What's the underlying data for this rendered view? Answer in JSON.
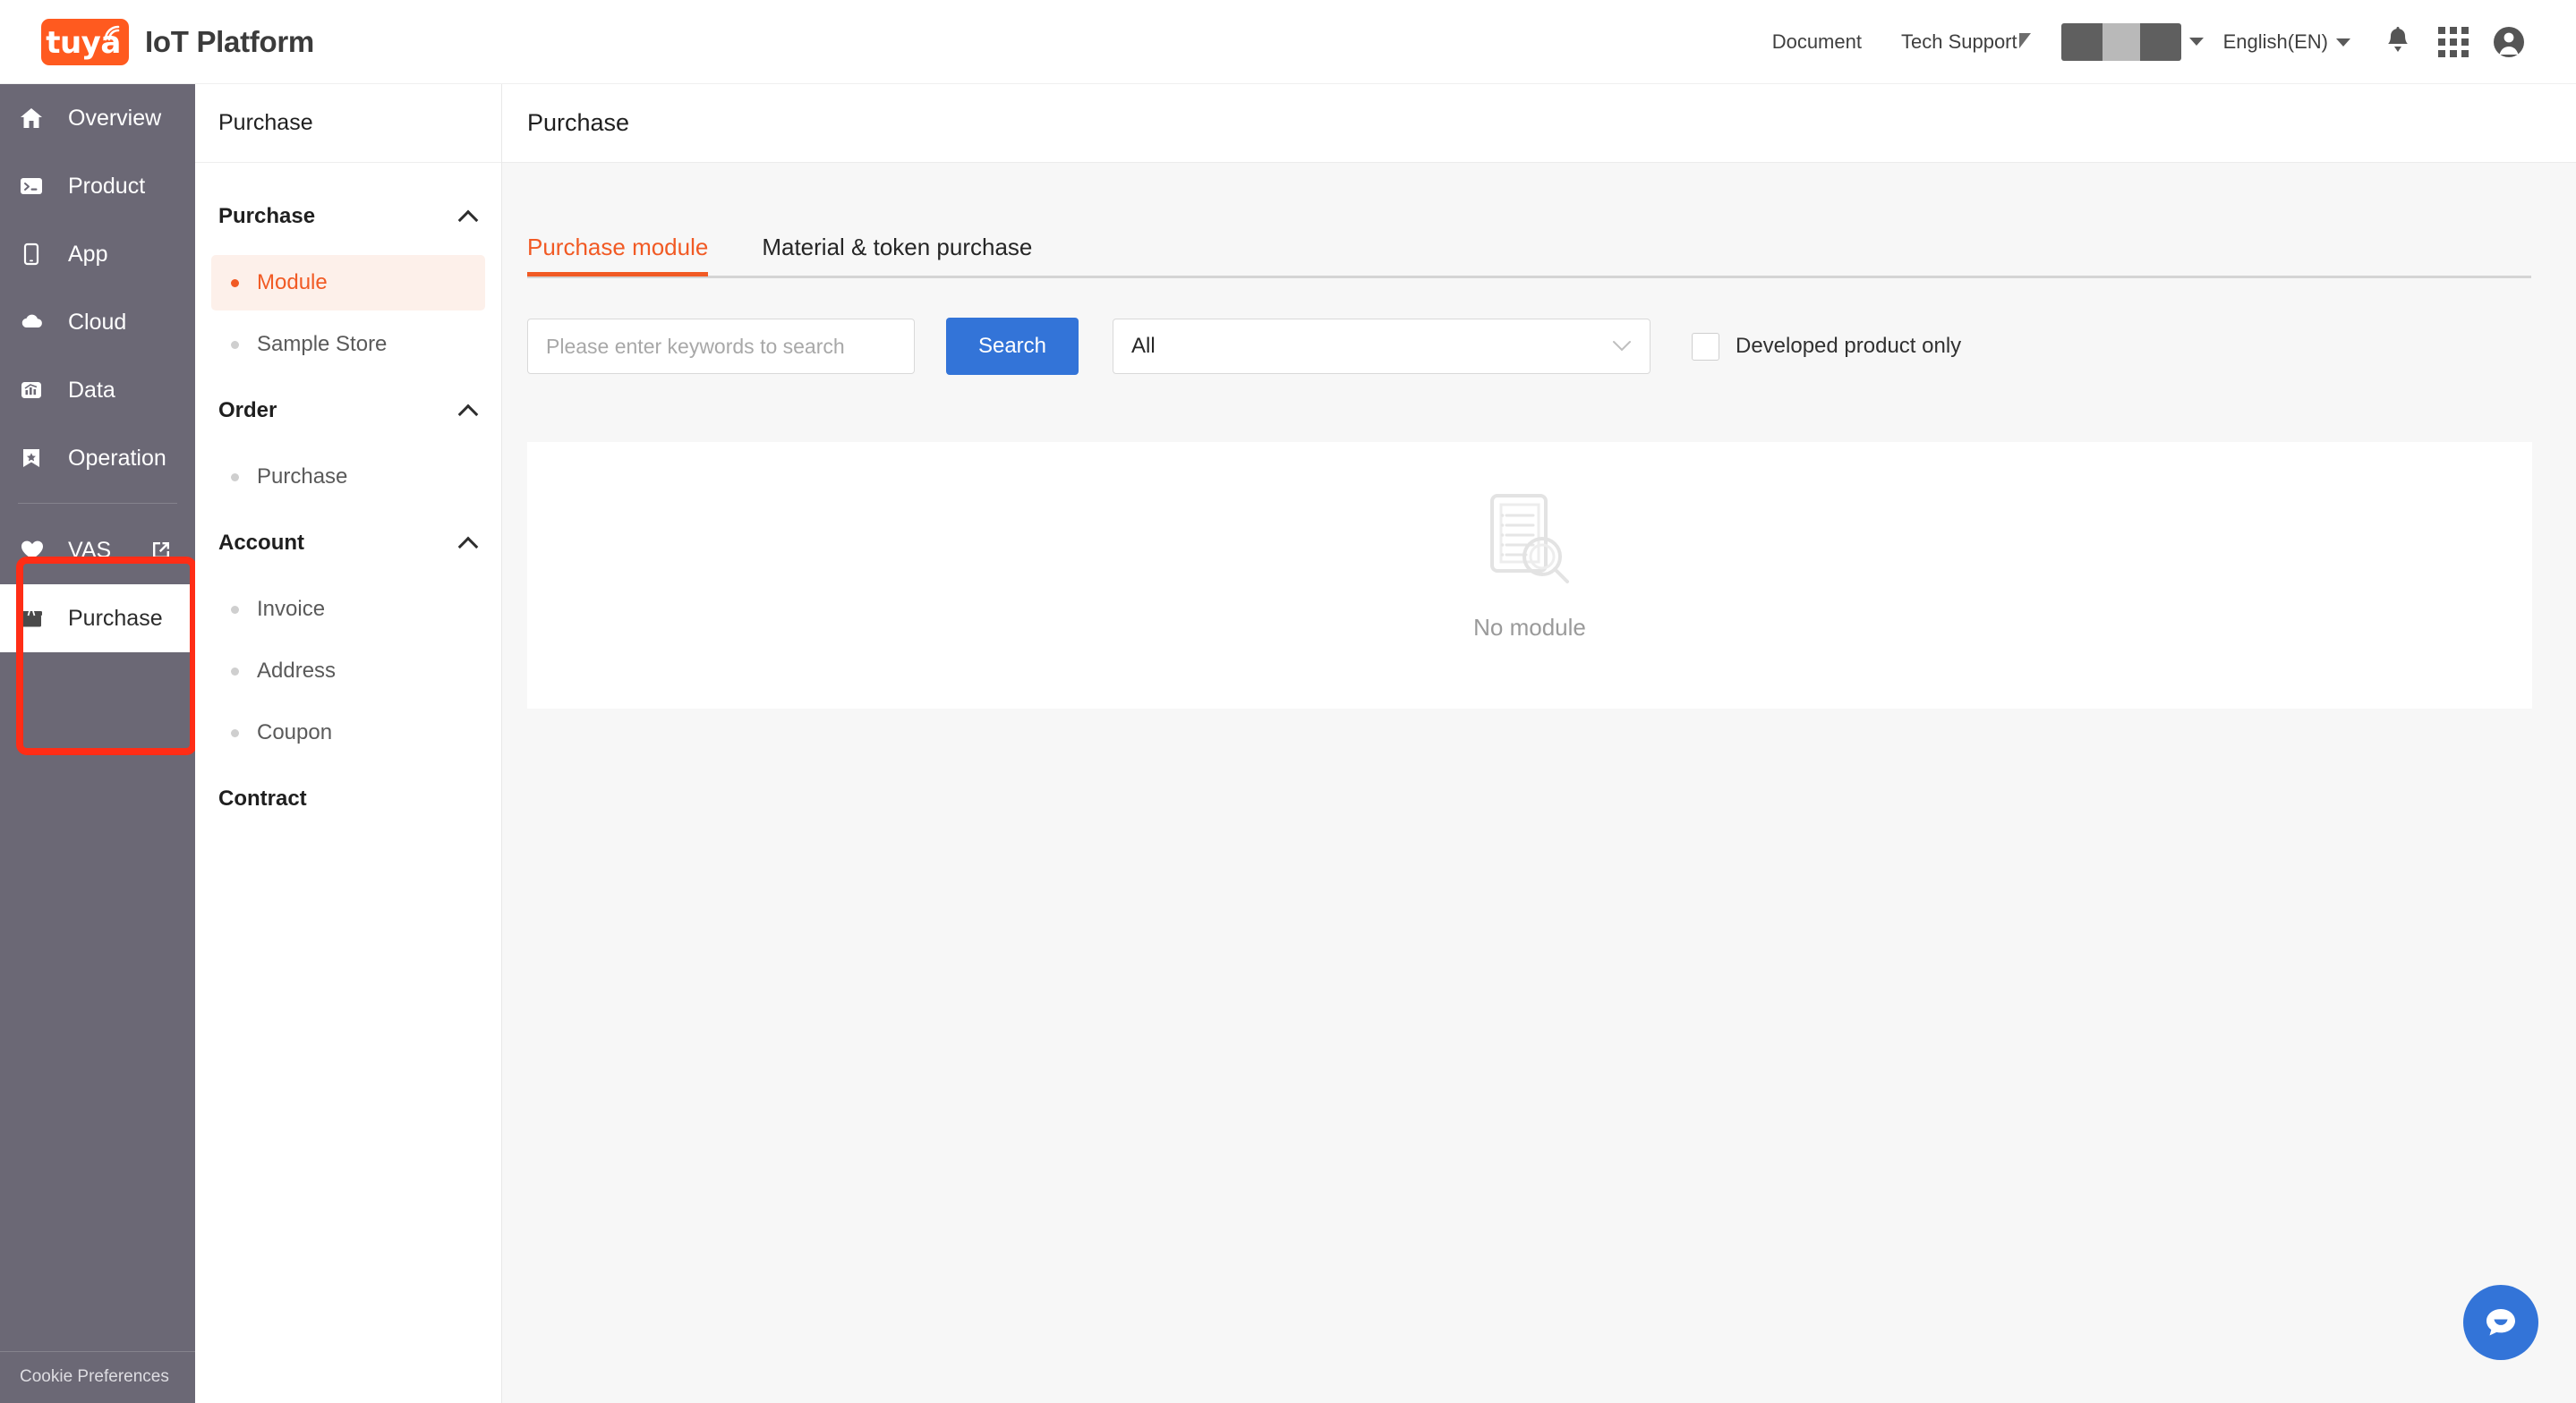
{
  "brand": {
    "logo_text": "tuya",
    "title": "IoT Platform"
  },
  "header": {
    "document_label": "Document",
    "tech_support_label": "Tech Support",
    "account_redacted": "",
    "language_label": "English(EN)",
    "icons": {
      "notification": "bell-icon",
      "apps": "grid-apps-icon",
      "profile": "user-account-icon"
    }
  },
  "sidebar": {
    "items": [
      {
        "label": "Overview",
        "icon": "home-icon",
        "active": false,
        "external": false
      },
      {
        "label": "Product",
        "icon": "terminal-icon",
        "active": false,
        "external": false
      },
      {
        "label": "App",
        "icon": "mobile-icon",
        "active": false,
        "external": false
      },
      {
        "label": "Cloud",
        "icon": "cloud-icon",
        "active": false,
        "external": false
      },
      {
        "label": "Data",
        "icon": "chart-icon",
        "active": false,
        "external": false
      },
      {
        "label": "Operation",
        "icon": "bookmark-star-icon",
        "active": false,
        "external": false
      },
      {
        "label": "VAS",
        "icon": "heart-icon",
        "active": false,
        "external": true
      },
      {
        "label": "Purchase",
        "icon": "package-box-icon",
        "active": true,
        "external": false
      }
    ],
    "cookie_label": "Cookie Preferences",
    "highlight_color": "#ff2d16"
  },
  "subnav": {
    "title": "Purchase",
    "groups": [
      {
        "label": "Purchase",
        "collapsible": true,
        "items": [
          {
            "label": "Module",
            "active": true
          },
          {
            "label": "Sample Store",
            "active": false
          }
        ]
      },
      {
        "label": "Order",
        "collapsible": true,
        "items": [
          {
            "label": "Purchase",
            "active": false
          }
        ]
      },
      {
        "label": "Account",
        "collapsible": true,
        "items": [
          {
            "label": "Invoice",
            "active": false
          },
          {
            "label": "Address",
            "active": false
          },
          {
            "label": "Coupon",
            "active": false
          }
        ]
      },
      {
        "label": "Contract",
        "collapsible": false,
        "items": []
      }
    ]
  },
  "main": {
    "page_title": "Purchase",
    "tabs": [
      {
        "label": "Purchase module",
        "active": true
      },
      {
        "label": "Material & token purchase",
        "active": false
      }
    ],
    "search": {
      "placeholder": "Please enter keywords to search",
      "value": "",
      "button_label": "Search"
    },
    "filter_select": {
      "value": "All",
      "options": [
        "All"
      ]
    },
    "checkbox": {
      "label": "Developed product only",
      "checked": false
    },
    "empty_state": {
      "text": "No module",
      "icon": "document-search-empty-icon"
    }
  },
  "fab": {
    "icon": "chat-bubble-icon"
  },
  "colors": {
    "brand_orange": "#f15a24",
    "logo_orange": "#ff5a1f",
    "primary_blue": "#3374d8",
    "sidebar_bg": "#6b6875",
    "content_bg": "#f7f7f7",
    "annotation_red": "#ff2d16"
  }
}
